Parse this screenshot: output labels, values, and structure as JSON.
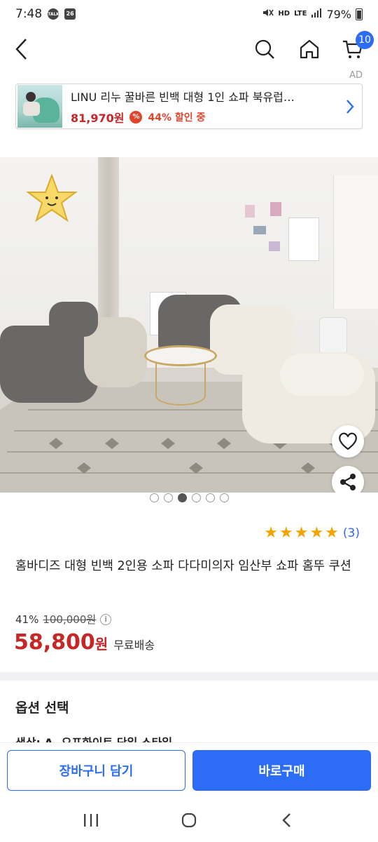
{
  "status_bar": {
    "time": "7:48",
    "notif_icons": [
      "talk-icon",
      "calendar-icon"
    ],
    "calendar_day": "26",
    "talk_label": "TALK",
    "network_hd": "HD",
    "network_lte": "LTE",
    "battery": "79%"
  },
  "header": {
    "cart_count": "10"
  },
  "ad": {
    "label": "AD",
    "title": "LINU 리누 꿀바른 빈백 대형 1인 쇼파 북유럽…",
    "price": "81,970원",
    "discount": "44% 할인 중"
  },
  "product": {
    "image_dots": 6,
    "active_dot": 2,
    "rating_stars": 5,
    "review_count": "(3)",
    "title": "홈바디즈 대형 빈백 2인용 소파 다다미의자 임산부 쇼파 홈뚜 쿠션",
    "discount_rate": "41%",
    "original_price": "100,000원",
    "sale_price": "58,800",
    "sale_unit": "원",
    "shipping": "무료배송"
  },
  "options": {
    "title": "옵션 선택",
    "peek_text": "색상: A. 오프화이트 단일 스타일"
  },
  "actions": {
    "add_to_cart": "장바구니 담기",
    "buy_now": "바로구매"
  },
  "colors": {
    "accent": "#2d6cf5",
    "price_red": "#c62626",
    "star": "#f5a300"
  }
}
